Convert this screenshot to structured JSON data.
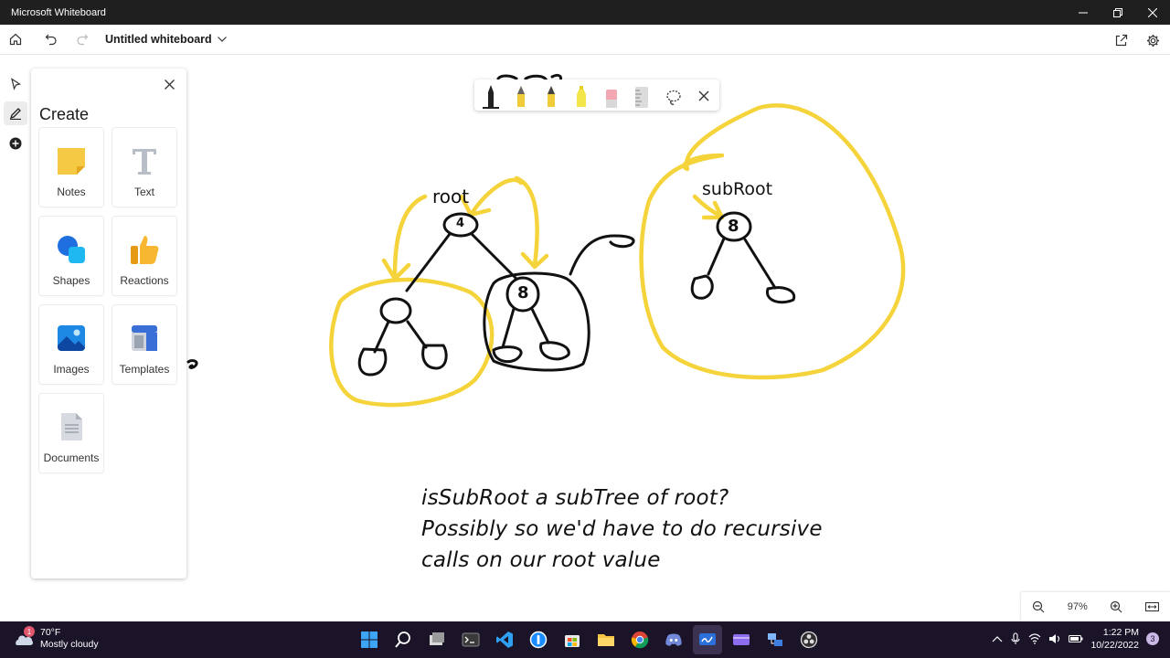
{
  "window": {
    "title": "Microsoft Whiteboard"
  },
  "appbar": {
    "board_name": "Untitled whiteboard"
  },
  "panel": {
    "heading": "Create",
    "tiles": [
      {
        "label": "Notes",
        "icon": "sticky-note-icon"
      },
      {
        "label": "Text",
        "icon": "text-icon"
      },
      {
        "label": "Shapes",
        "icon": "shapes-icon"
      },
      {
        "label": "Reactions",
        "icon": "thumbs-up-icon"
      },
      {
        "label": "Images",
        "icon": "image-icon"
      },
      {
        "label": "Templates",
        "icon": "templates-icon"
      },
      {
        "label": "Documents",
        "icon": "document-icon"
      }
    ]
  },
  "canvas": {
    "label_root": "root",
    "label_subroot": "subRoot",
    "node_root": "4",
    "node_right": "8",
    "node_subroot": "8",
    "note_lines": [
      "isSubRoot a subTree of root?",
      "Possibly so we'd have to do recursive",
      "calls on our root value"
    ]
  },
  "zoom": {
    "level": "97%"
  },
  "taskbar": {
    "weather_temp": "70°F",
    "weather_desc": "Mostly cloudy",
    "weather_badge": "1",
    "time": "1:22 PM",
    "date": "10/22/2022",
    "notification_count": "3"
  },
  "colors": {
    "ink_yellow": "#f5d33a",
    "ink_black": "#111111",
    "taskbar_bg": "#1b1429"
  }
}
